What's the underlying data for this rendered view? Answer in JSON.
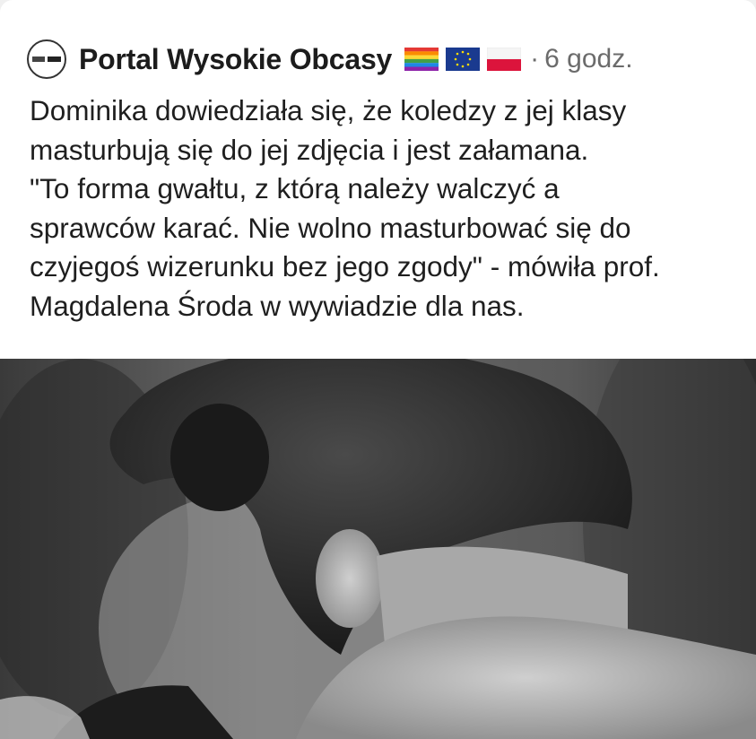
{
  "post": {
    "author": "Portal Wysokie Obcasy",
    "timestamp": "6 godz.",
    "separator": "·",
    "flags": [
      "rainbow-flag-icon",
      "eu-flag-icon",
      "poland-flag-icon"
    ],
    "text": "Dominika dowiedziała się, że koledzy z jej klasy\nmasturbują się do jej zdjęcia i jest załamana.\n\"To forma gwałtu, z którą należy walczyć a\nsprawców karać. Nie wolno masturbować się do\nczyjegoś wizerunku bez jego zgody\" - mówiła prof.\nMagdalena Środa w wywiadzie dla nas."
  },
  "colors": {
    "author_text": "#1c1c1c",
    "meta_text": "#6b6b6b",
    "body_text": "#1f1f1f",
    "card_background": "#ffffff"
  }
}
